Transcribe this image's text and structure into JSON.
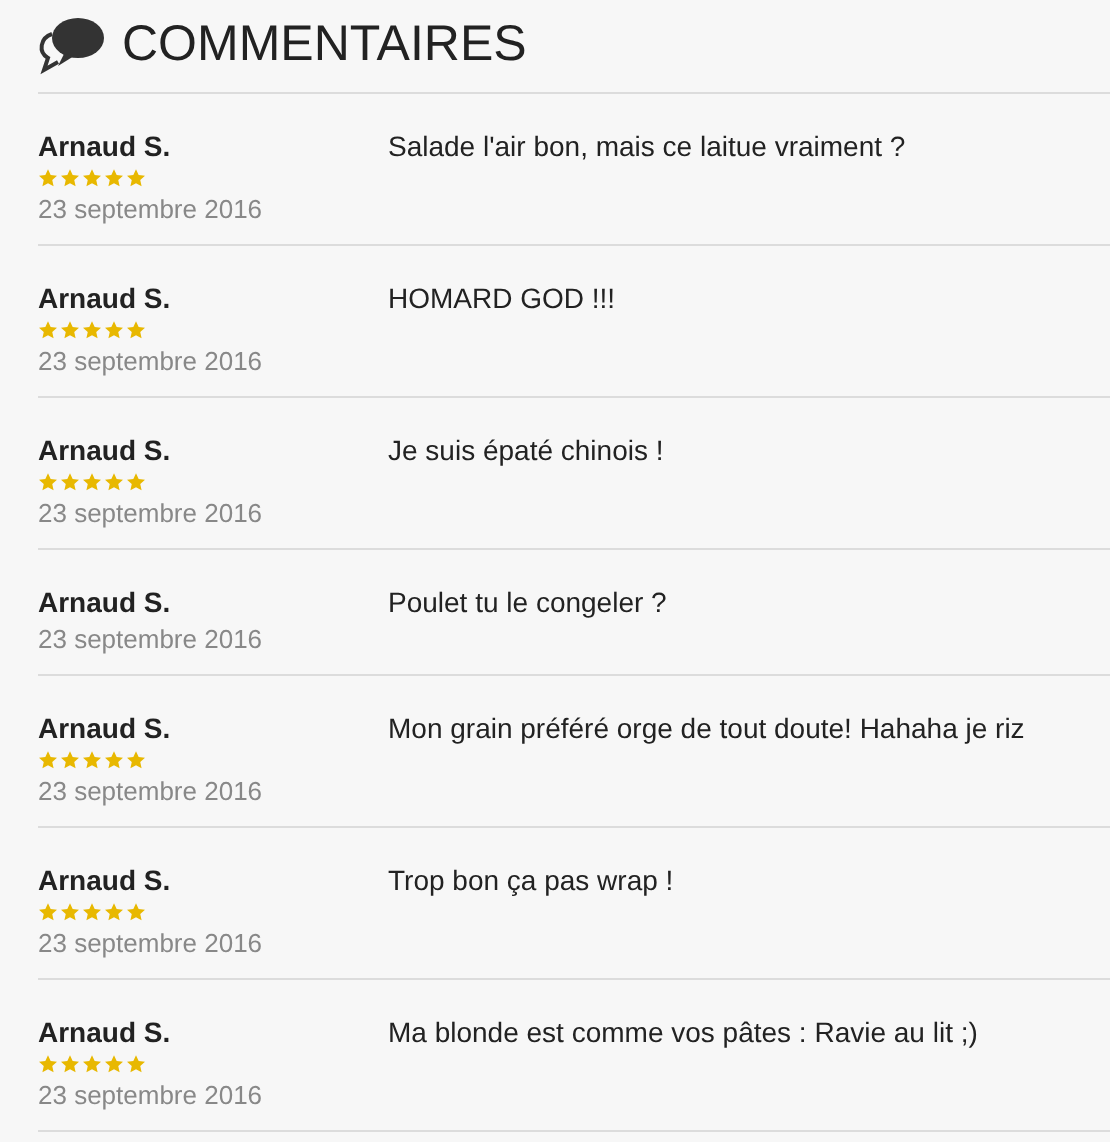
{
  "header": {
    "title": "COMMENTAIRES"
  },
  "comments": [
    {
      "author": "Arnaud S.",
      "stars": 5,
      "date": "23 septembre 2016",
      "text": "Salade l'air bon, mais ce laitue vraiment ?"
    },
    {
      "author": "Arnaud S.",
      "stars": 5,
      "date": "23 septembre 2016",
      "text": "HOMARD GOD !!!"
    },
    {
      "author": "Arnaud S.",
      "stars": 5,
      "date": "23 septembre 2016",
      "text": "Je suis épaté chinois !"
    },
    {
      "author": "Arnaud S.",
      "date": "23 septembre 2016",
      "text": "Poulet tu le congeler ?"
    },
    {
      "author": "Arnaud S.",
      "stars": 5,
      "date": "23 septembre 2016",
      "text": "Mon grain préféré orge de tout doute! Hahaha je riz"
    },
    {
      "author": "Arnaud S.",
      "stars": 5,
      "date": "23 septembre 2016",
      "text": "Trop bon ça pas wrap !"
    },
    {
      "author": "Arnaud S.",
      "stars": 5,
      "date": "23 septembre 2016",
      "text": "Ma blonde est comme vos pâtes : Ravie au lit ;)"
    }
  ]
}
